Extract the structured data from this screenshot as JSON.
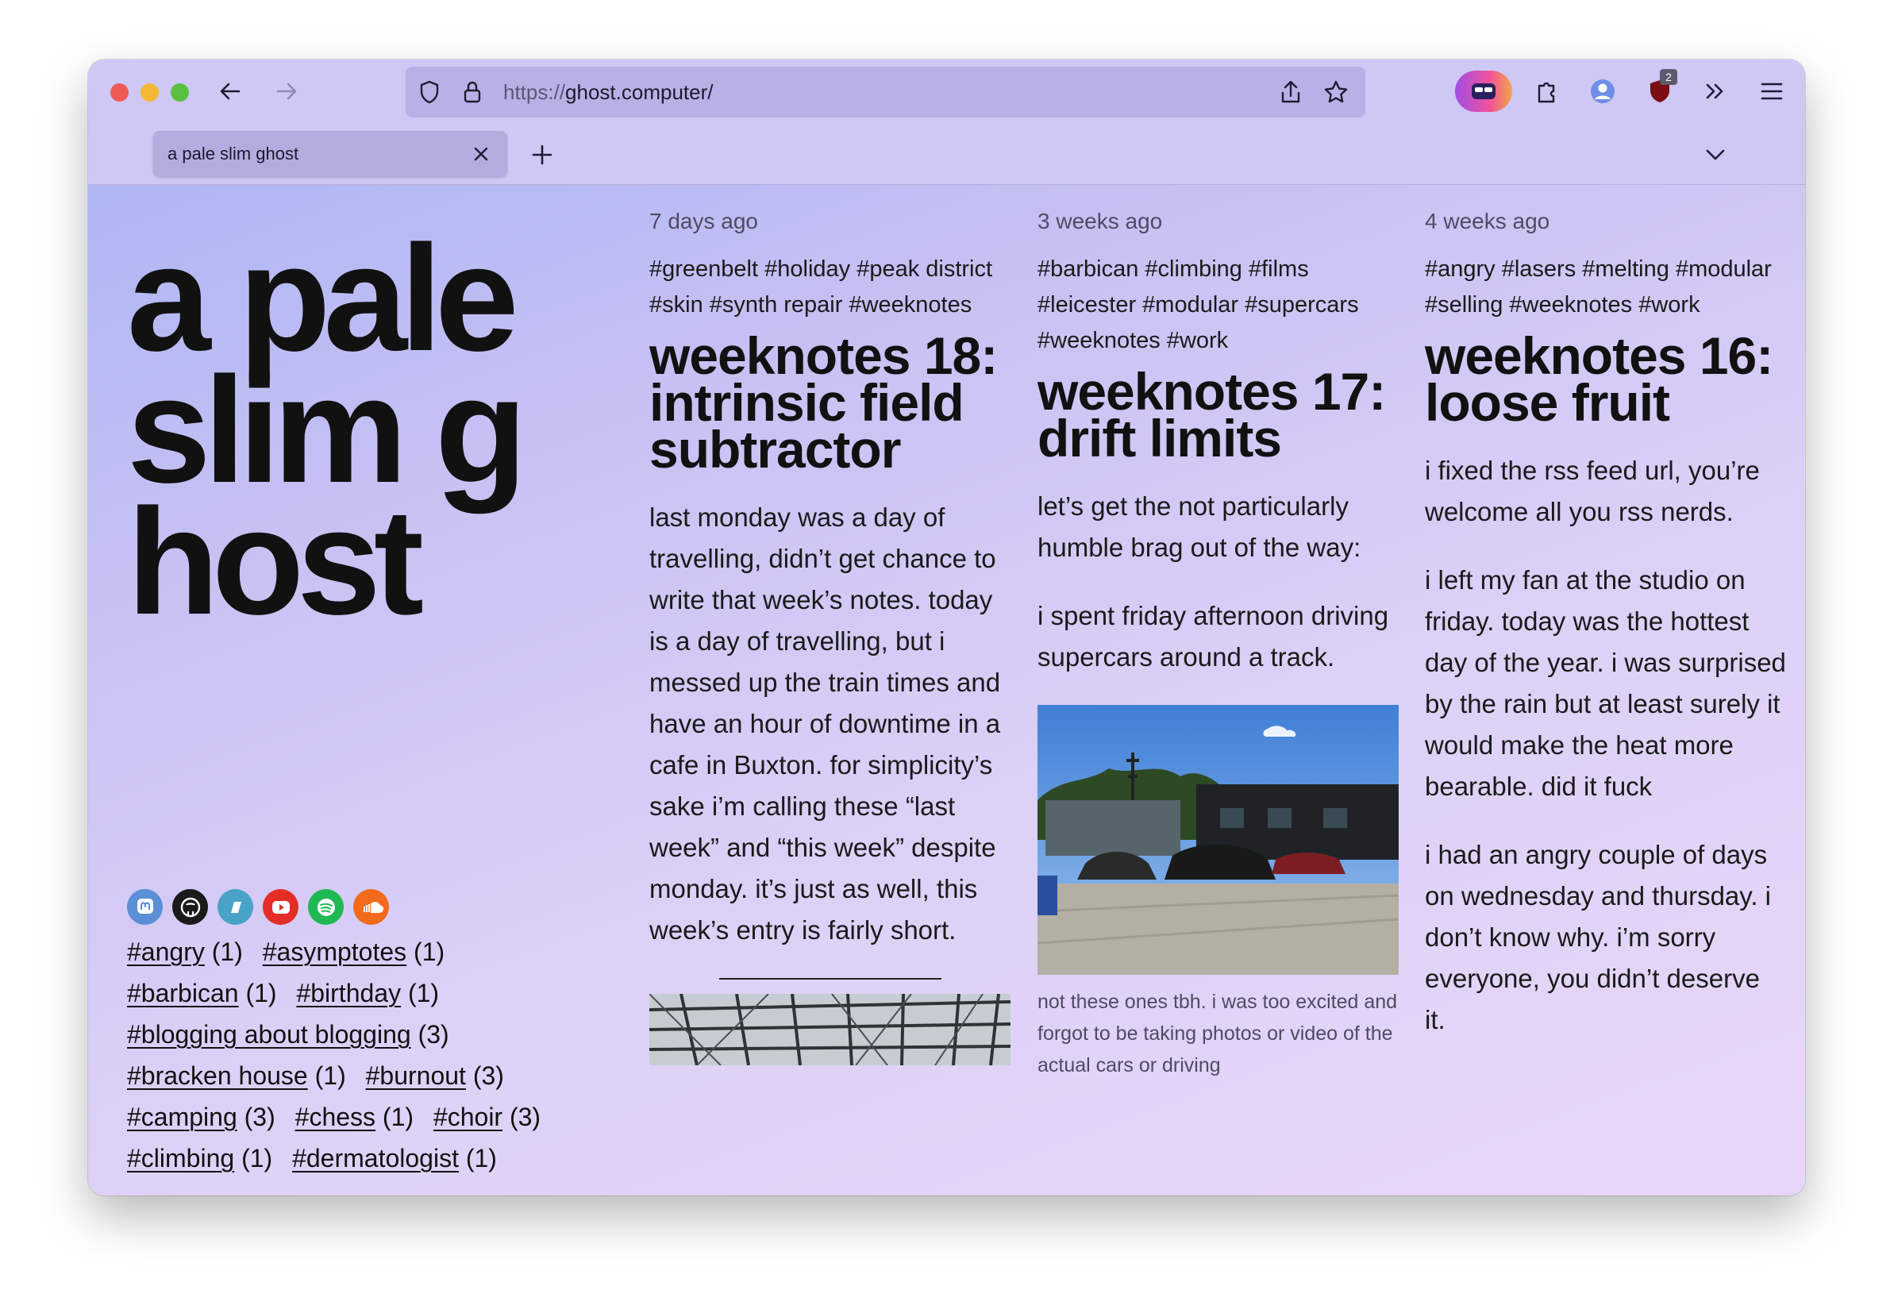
{
  "browser": {
    "url_protocol": "https://",
    "url_host": "ghost.computer/",
    "tab_title": "a pale slim ghost",
    "extension_badge": "2"
  },
  "site": {
    "title": "a pale slim ghost",
    "socials": [
      {
        "name": "mastodon",
        "color": "#5b8fd6"
      },
      {
        "name": "github",
        "color": "#1a1a1a"
      },
      {
        "name": "pixelfed",
        "color": "#49a3c6"
      },
      {
        "name": "youtube",
        "color": "#e52d27"
      },
      {
        "name": "spotify",
        "color": "#1fb954"
      },
      {
        "name": "soundcloud",
        "color": "#f26b1d"
      }
    ],
    "tags": [
      {
        "name": "#angry",
        "count": "(1)"
      },
      {
        "name": "#asymptotes",
        "count": "(1)"
      },
      {
        "name": "#barbican",
        "count": "(1)"
      },
      {
        "name": "#birthday",
        "count": "(1)"
      },
      {
        "name": "#blogging about blogging",
        "count": "(3)"
      },
      {
        "name": "#bracken house",
        "count": "(1)"
      },
      {
        "name": "#burnout",
        "count": "(3)"
      },
      {
        "name": "#camping",
        "count": "(3)"
      },
      {
        "name": "#chess",
        "count": "(1)"
      },
      {
        "name": "#choir",
        "count": "(3)"
      },
      {
        "name": "#climbing",
        "count": "(1)"
      },
      {
        "name": "#dermatologist",
        "count": "(1)"
      }
    ]
  },
  "posts": [
    {
      "date": "7 days ago",
      "tags": "#greenbelt #holiday #peak district #skin #synth repair #weeknotes",
      "title": "weeknotes 18: intrinsic field subtractor",
      "paragraphs": [
        "last monday was a day of travelling, didn’t get chance to write that week’s notes. today is a day of travelling, but i messed up the train times and have an hour of downtime in a cafe in Buxton. for simplicity’s sake i’m calling these “last week” and “this week” despite monday. it’s just as well, this week’s entry is fairly short."
      ]
    },
    {
      "date": "3 weeks ago",
      "tags": "#barbican #climbing #films #leicester #modular #supercars #weeknotes #work",
      "title": "weeknotes 17: drift limits",
      "paragraphs": [
        "let’s get the not particularly humble brag out of the way:",
        "i spent friday afternoon driving supercars around a track."
      ],
      "caption": "not these ones tbh. i was too excited and forgot to be taking photos or video of the actual cars or driving"
    },
    {
      "date": "4 weeks ago",
      "tags": "#angry #lasers #melting #modular #selling #weeknotes #work",
      "title": "weeknotes 16: loose fruit",
      "paragraphs": [
        "i fixed the rss feed url, you’re welcome all you rss nerds.",
        "i left my fan at the studio on friday. today was the hottest day of the year. i was surprised by the rain but at least surely it would make the heat more bearable. did it fuck",
        "i had an angry couple of days on wednesday and thursday. i don’t know why. i’m sorry everyone, you didn’t deserve it."
      ]
    }
  ]
}
